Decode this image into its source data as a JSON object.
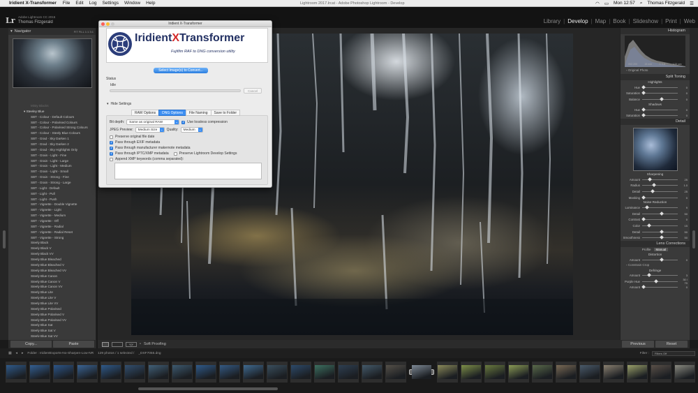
{
  "menubar": {
    "app": "Iridient X-Transformer",
    "items": [
      "File",
      "Edit",
      "Log",
      "Settings",
      "Window",
      "Help"
    ],
    "center_title": "Lightroom 2017.lrcat - Adobe Photoshop Lightroom - Develop",
    "clock": "Mon 12:57",
    "user": "Thomas Fitzgerald"
  },
  "lr": {
    "logo": "Lr",
    "version": "Adobe Lightroom CC 2015",
    "owner": "Thomas Fitzgerald",
    "modules": [
      "Library",
      "Develop",
      "Map",
      "Book",
      "Slideshow",
      "Print",
      "Web"
    ],
    "active_module": "Develop"
  },
  "left_panel": {
    "navigator_label": "Navigator",
    "nav_options": "FIT  FILL  1:1  3:1",
    "folder_faint": "Misty Blacks",
    "folder": "Steeley Blue",
    "presets": [
      "SBT - Colour - Default Colours",
      "SBT - Colour - Polarised Colours",
      "SBT - Colour - Polarised Strong Colours",
      "SBT - Colour - Steely Blue Colours",
      "SBT - Grad - Sky Darken 1",
      "SBT - Grad - Sky Darken 2",
      "SBT - Grad - Sky Highlights Only",
      "SBT - Grain - Light - Fine",
      "SBT - Grain - Light - Large",
      "SBT - Grain - Light - Medium",
      "SBT - Grain - Light - Small",
      "SBT - Grain - Strong - Fine",
      "SBT - Grain - Strong - Large",
      "SBT - Light - Default",
      "SBT - Light - Pull",
      "SBT - Light - Push",
      "SBT - Vignette - Double Vignette",
      "SBT - Vignette - Light",
      "SBT - Vignette - Medium",
      "SBT - Vignette - Off",
      "SBT - Vignette - Radial",
      "SBT - Vignette - Radial Reset",
      "SBT - Vignette - Strong",
      "Steely Black",
      "Steely Black V",
      "Steely Black VV",
      "Steely Blue Bleached",
      "Steely Blue Bleached V",
      "Steely Blue Bleached VV",
      "Steely Blue Canon",
      "Steely Blue Canon V",
      "Steely Blue Canon VV",
      "Steely Blue Lite",
      "Steely Blue Lite V",
      "Steely Blue Lite VV",
      "Steely Blue Polarised",
      "Steely Blue Polarised V",
      "Steely Blue Polarised VV",
      "Steely Blue Sat",
      "Steely Blue Sat V",
      "Steely Blue Sat VV"
    ],
    "copy_label": "Copy...",
    "paste_label": "Paste"
  },
  "toolbar": {
    "soft_proofing": "Soft Proofing",
    "view_label": "Y|Y"
  },
  "right_panel": {
    "histogram_label": "Histogram",
    "histo_readout": [
      "ISO 200",
      "15 mm",
      "f / 2.8",
      "1/15 sec"
    ],
    "original_photo": "Original Photo",
    "split_toning_label": "Split Toning",
    "highlights_label": "Highlights",
    "shadows_label": "Shadows",
    "split_sliders": [
      {
        "label": "Hue",
        "value": "0"
      },
      {
        "label": "Saturation",
        "value": "0"
      },
      {
        "label": "Balance",
        "value": "0"
      },
      {
        "label": "Hue",
        "value": "0"
      },
      {
        "label": "Saturation",
        "value": "0"
      }
    ],
    "detail_label": "Detail",
    "sharpening_label": "Sharpening",
    "sharpening_sliders": [
      {
        "label": "Amount",
        "value": "25"
      },
      {
        "label": "Radius",
        "value": "1.0"
      },
      {
        "label": "Detail",
        "value": "25"
      },
      {
        "label": "Masking",
        "value": "0"
      }
    ],
    "noise_label": "Noise Reduction",
    "noise_sliders": [
      {
        "label": "Luminance",
        "value": "9"
      },
      {
        "label": "Detail",
        "value": "50"
      },
      {
        "label": "Contrast",
        "value": "0"
      },
      {
        "label": "Color",
        "value": "15"
      },
      {
        "label": "Detail",
        "value": "50"
      },
      {
        "label": "Smoothness",
        "value": "50"
      }
    ],
    "lens_label": "Lens Corrections",
    "lens_tabs": [
      "Profile",
      "Manual"
    ],
    "lens_active": "Manual",
    "distortion_label": "Distortion",
    "distortion_amount": {
      "label": "Amount",
      "value": "0"
    },
    "constrain_crop": "Constrain Crop",
    "defringe_label": "Defringe",
    "defringe_sliders": [
      {
        "label": "Amount",
        "value": "3"
      },
      {
        "label": "Purple Hue",
        "value": "30 / 70"
      },
      {
        "label": "Amount",
        "value": "0"
      }
    ],
    "previous_label": "Previous",
    "reset_label": "Reset"
  },
  "filmstrip": {
    "folder_info": "Folder : IridientExports-No-Sharpen-Low-NR",
    "count_info": "129 photos / 1 selected /",
    "file_name": "_DSF7055.dng",
    "filter_label": "Filter :",
    "filter_value": "Filters Off",
    "selected_index": 17,
    "thumb_colors": [
      "#2f5a8a",
      "#335f92",
      "#2c5588",
      "#3a6494",
      "#2f5a8a",
      "#324f6f",
      "#416078",
      "#3d5a70",
      "#2f5a8a",
      "#345a84",
      "#3f6a90",
      "#3a4f5e",
      "#2d4a6a",
      "#3c7060",
      "#2e3f52",
      "#445a6a",
      "#555048",
      "#7d8894",
      "#8b8a5a",
      "#7e8f48",
      "#6a7a3e",
      "#8a9a55",
      "#5a6a4a",
      "#7a6a55",
      "#4a5a6a",
      "#8a8070",
      "#9aa06a",
      "#5a5048",
      "#8a8a80",
      "#3a3a3a",
      "#6a8a9a"
    ]
  },
  "dialog": {
    "window_title": "Iridient X-Transformer",
    "brand_pre": "Iridient",
    "brand_x": "X",
    "brand_post": "Transformer",
    "tagline": "Fujifilm RAF to DNG conversion utility",
    "select_button": "Select Image(s) to Convert...",
    "status_label": "Status",
    "status_value": "Idle",
    "cancel_label": "Cancel",
    "hide_settings": "Hide Settings",
    "tabs": [
      "RAW Options",
      "DNG Options",
      "File Naming",
      "Save to Folder"
    ],
    "active_tab": "DNG Options",
    "bit_depth_label": "Bit depth:",
    "bit_depth_value": "Same as original RAW",
    "lossless_label": "Use lossless compression",
    "jpeg_preview_label": "JPEG Preview:",
    "jpeg_preview_value": "Medium Size",
    "quality_label": "Quality:",
    "quality_value": "Medium",
    "checkboxes": [
      {
        "label": "Preserve original file date",
        "checked": false
      },
      {
        "label": "Pass through EXIF metadata",
        "checked": true
      },
      {
        "label": "Pass through manufacturer makernote metadata",
        "checked": true
      },
      {
        "label": "Pass through IPTC/XMP metadata",
        "checked": true
      },
      {
        "label": "Append XMP keywords (comma separated):",
        "checked": false
      }
    ],
    "preserve_lr_label": "Preserve Lightroom Develop Settings",
    "preserve_lr_checked": false
  }
}
